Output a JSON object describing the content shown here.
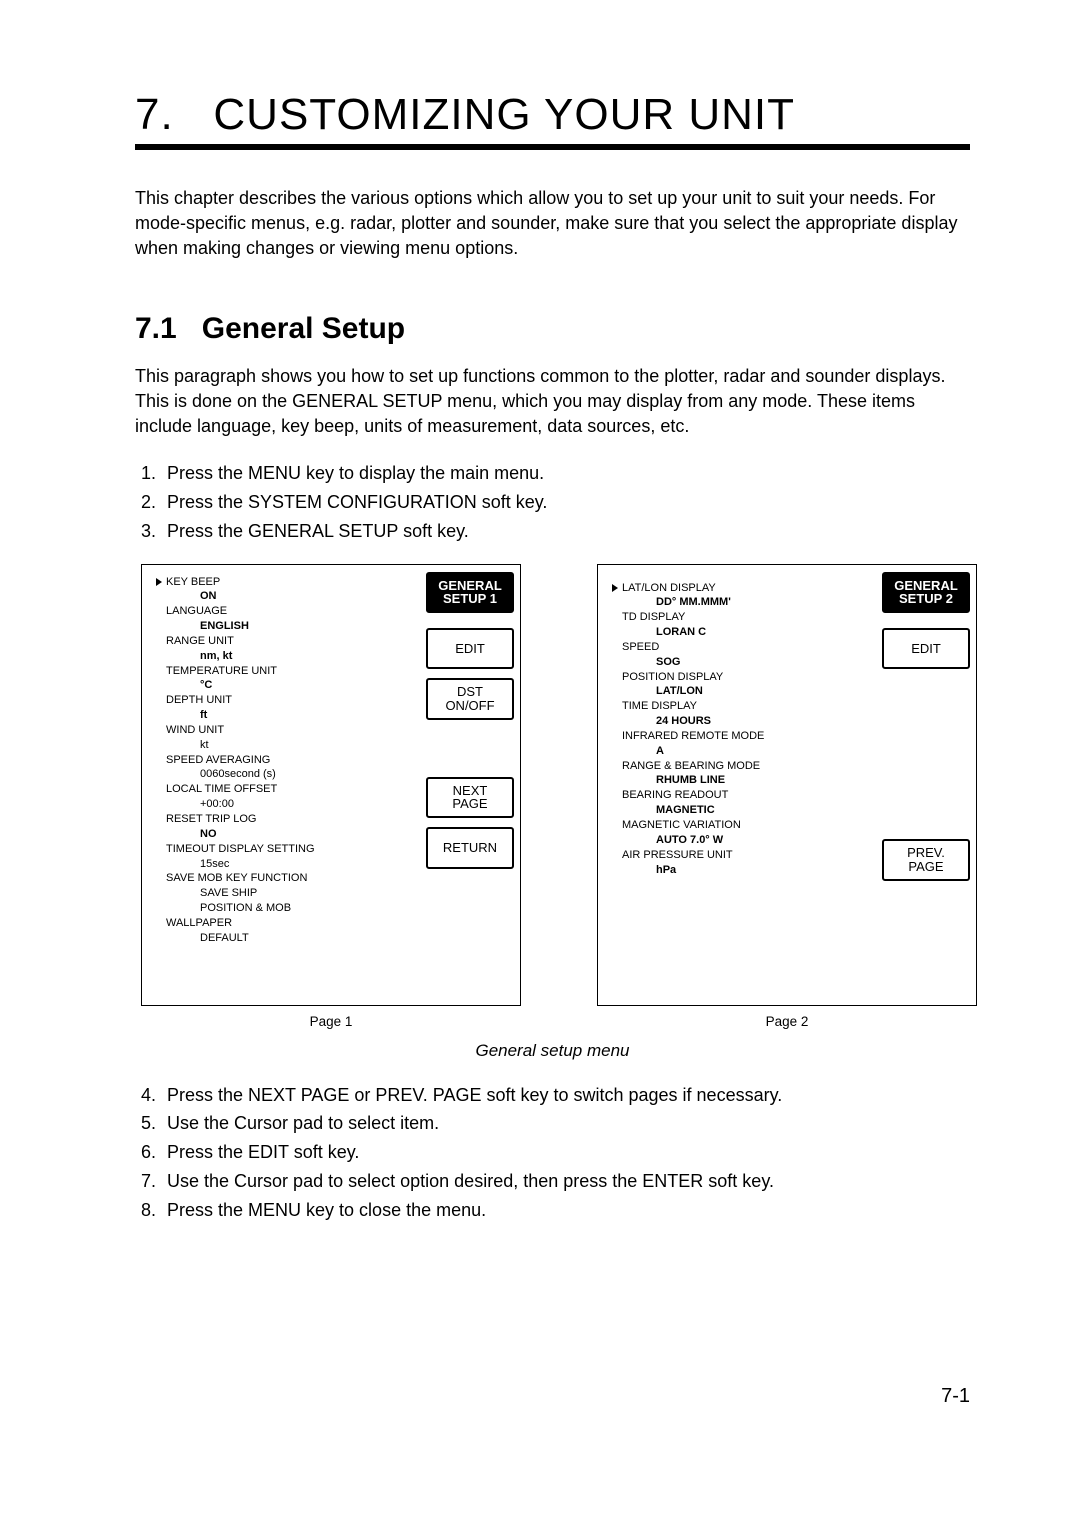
{
  "chapter": {
    "number": "7.",
    "title": "CUSTOMIZING YOUR UNIT",
    "intro": "This chapter describes the various options which allow you to set up your unit to suit your needs. For mode-specific menus, e.g. radar, plotter and sounder, make sure that you select the appropriate display when making changes or viewing menu options."
  },
  "section": {
    "number": "7.1",
    "title": "General Setup",
    "intro": "This paragraph shows you how to set up functions common to the plotter, radar and sounder displays. This is done on the GENERAL SETUP menu, which you may display from any mode. These items include language, key beep, units of measurement, data sources, etc."
  },
  "steps_a": [
    "Press the MENU key to display the main menu.",
    "Press the SYSTEM CONFIGURATION soft key.",
    "Press the GENERAL SETUP soft key."
  ],
  "steps_b": [
    "Press the NEXT PAGE or PREV. PAGE soft key to switch pages if necessary.",
    "Use the Cursor pad to select item.",
    "Press the EDIT soft key.",
    "Use the Cursor pad to select option desired, then press the ENTER soft key.",
    "Press the MENU key to close the menu."
  ],
  "screen1": {
    "caption": "Page 1",
    "softkeys": {
      "header_l1": "GENERAL",
      "header_l2": "SETUP 1",
      "edit": "EDIT",
      "dst_l1": "DST",
      "dst_l2": "ON/OFF",
      "next_l1": "NEXT",
      "next_l2": "PAGE",
      "ret": "RETURN"
    },
    "items": [
      {
        "label": "KEY BEEP",
        "value": "ON",
        "selected": true
      },
      {
        "label": "LANGUAGE",
        "value": "ENGLISH"
      },
      {
        "label": "RANGE UNIT",
        "value": "nm, kt"
      },
      {
        "label": "TEMPERATURE UNIT",
        "value": "°C"
      },
      {
        "label": "DEPTH UNIT",
        "value": "ft"
      },
      {
        "label": "WIND UNIT",
        "value": "kt",
        "nobold": true
      },
      {
        "label": "SPEED AVERAGING",
        "value": "0060second (s)",
        "nobold": true
      },
      {
        "label": "LOCAL TIME OFFSET",
        "value": "+00:00",
        "nobold": true
      },
      {
        "label": "RESET TRIP LOG",
        "value": "NO"
      },
      {
        "label": "TIMEOUT DISPLAY SETTING",
        "value": "15sec",
        "nobold": true
      },
      {
        "label": "SAVE MOB KEY FUNCTION",
        "value": "SAVE SHIP",
        "value2": "POSITION & MOB",
        "nobold": true
      },
      {
        "label": "WALLPAPER",
        "value": "DEFAULT",
        "nobold": true
      }
    ]
  },
  "screen2": {
    "caption": "Page 2",
    "softkeys": {
      "header_l1": "GENERAL",
      "header_l2": "SETUP 2",
      "edit": "EDIT",
      "prev_l1": "PREV.",
      "prev_l2": "PAGE"
    },
    "items": [
      {
        "label": "LAT/LON DISPLAY",
        "value": "DD° MM.MMM'",
        "selected": true
      },
      {
        "label": "TD DISPLAY",
        "value": "LORAN C"
      },
      {
        "label": "SPEED",
        "value": "SOG"
      },
      {
        "label": "POSITION DISPLAY",
        "value": "LAT/LON"
      },
      {
        "label": "TIME DISPLAY",
        "value": "24 HOURS"
      },
      {
        "label": "INFRARED REMOTE MODE",
        "value": "A"
      },
      {
        "label": "RANGE & BEARING MODE",
        "value": "RHUMB LINE"
      },
      {
        "label": "BEARING READOUT",
        "value": "MAGNETIC"
      },
      {
        "label": "MAGNETIC VARIATION",
        "value": "AUTO   7.0° W"
      },
      {
        "label": "AIR PRESSURE UNIT",
        "value": "hPa"
      }
    ]
  },
  "figure_caption": "General setup menu",
  "page_number": "7-1"
}
